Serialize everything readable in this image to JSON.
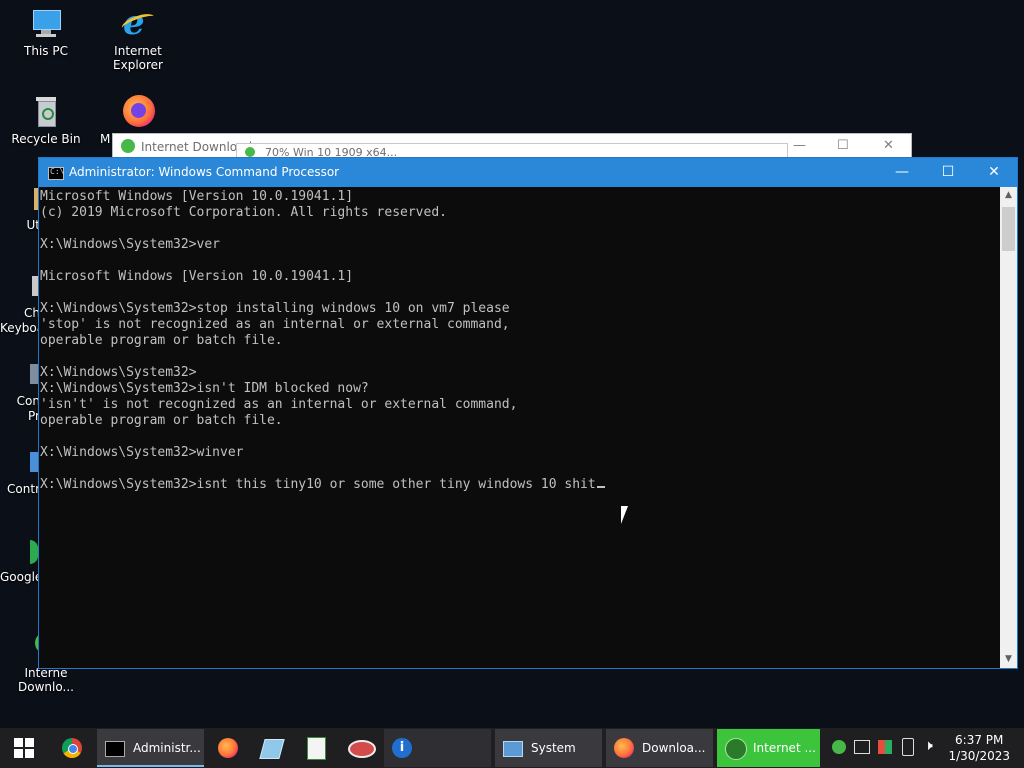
{
  "desktop": {
    "icons": [
      {
        "label": "This PC"
      },
      {
        "label": "Internet Explorer"
      },
      {
        "label": "Recycle Bin"
      },
      {
        "label": "M"
      },
      {
        "label": "Ut"
      },
      {
        "label": "Ch"
      },
      {
        "label": "Keyboa"
      },
      {
        "label": "Con"
      },
      {
        "label": "Pr"
      },
      {
        "label": "Contr"
      },
      {
        "label": "Google"
      },
      {
        "label": "Interne"
      },
      {
        "label": "Downlo..."
      }
    ]
  },
  "background_windows": {
    "idm_title": "Internet Download",
    "progress_title": "70% Win 10 1909 x64..."
  },
  "cmd": {
    "title": "Administrator: Windows Command Processor",
    "minimize": "—",
    "maximize": "☐",
    "close": "✕",
    "lines": [
      "Microsoft Windows [Version 10.0.19041.1]",
      "(c) 2019 Microsoft Corporation. All rights reserved.",
      "",
      "X:\\Windows\\System32>ver",
      "",
      "Microsoft Windows [Version 10.0.19041.1]",
      "",
      "X:\\Windows\\System32>stop installing windows 10 on vm7 please",
      "'stop' is not recognized as an internal or external command,",
      "operable program or batch file.",
      "",
      "X:\\Windows\\System32>",
      "X:\\Windows\\System32>isn't IDM blocked now?",
      "'isn't' is not recognized as an internal or external command,",
      "operable program or batch file.",
      "",
      "X:\\Windows\\System32>winver",
      "",
      "X:\\Windows\\System32>isnt this tiny10 or some other tiny windows 10 shit"
    ]
  },
  "taskbar": {
    "start_icon": "windows-logo-icon",
    "buttons": [
      {
        "label": "Administr..."
      },
      {
        "label": "System"
      },
      {
        "label": "Downloa..."
      },
      {
        "label": "Internet ..."
      }
    ],
    "clock_time": "6:37 PM",
    "clock_date": "1/30/2023"
  },
  "colors": {
    "titlebar": "#2b88d8",
    "console_bg": "#0c0c0c",
    "console_text": "#c0c0c0",
    "taskbar": "#1f1f22",
    "idm_active": "#3cc43c"
  }
}
